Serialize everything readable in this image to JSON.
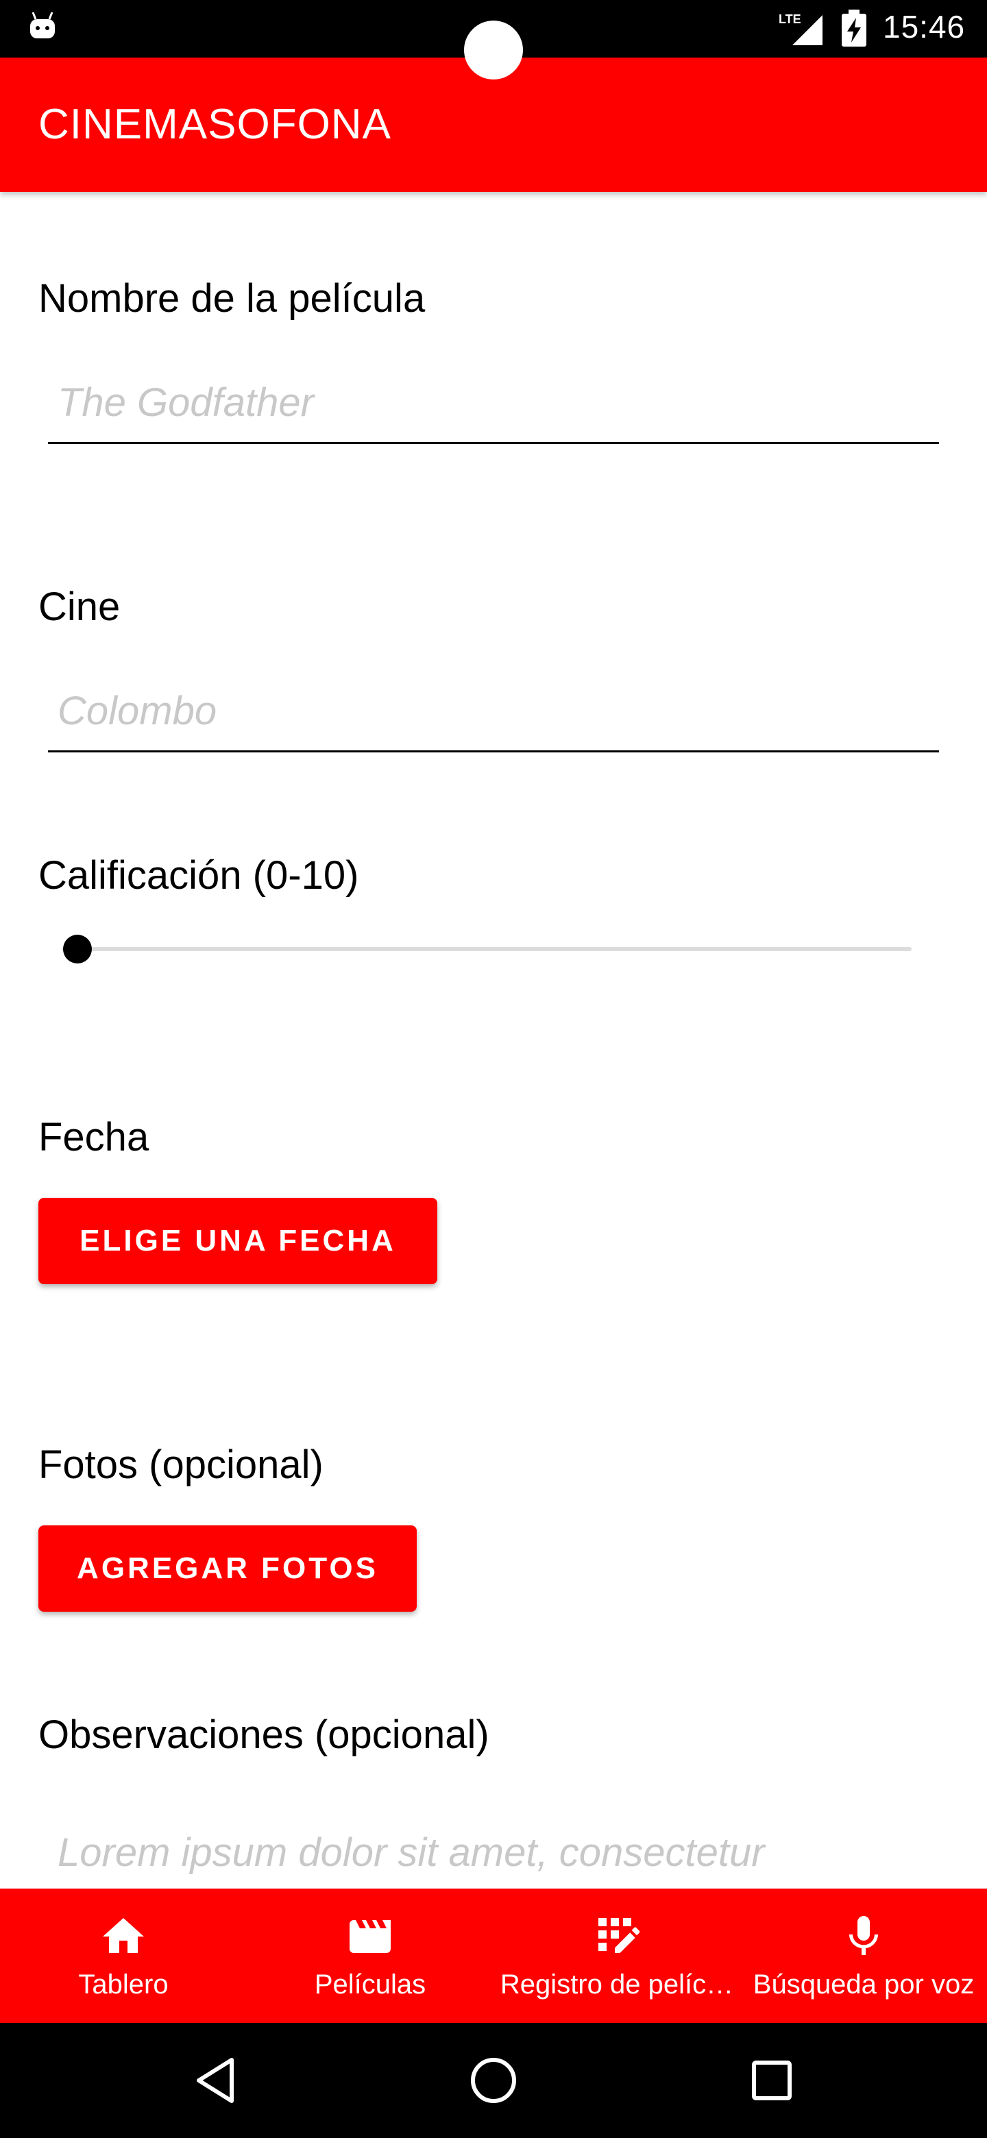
{
  "status_bar": {
    "time": "15:46",
    "lte_label": "LTE",
    "icons": [
      "android-debug-icon",
      "lte-signal-icon",
      "battery-charging-icon"
    ]
  },
  "app_bar": {
    "title": "CINEMASOFONA"
  },
  "form": {
    "movie_name": {
      "label": "Nombre de la película",
      "placeholder": "The Godfather",
      "value": ""
    },
    "cinema": {
      "label": "Cine",
      "placeholder": "Colombo",
      "value": ""
    },
    "rating": {
      "label": "Calificación (0-10)",
      "value": 0,
      "min": 0,
      "max": 10
    },
    "date": {
      "label": "Fecha",
      "button_label": "ELIGE UNA FECHA"
    },
    "photos": {
      "label": "Fotos (opcional)",
      "button_label": "AGREGAR FOTOS"
    },
    "notes": {
      "label": "Observaciones (opcional)",
      "placeholder": "Lorem ipsum dolor sit amet, consectetur"
    }
  },
  "bottom_nav": {
    "items": [
      {
        "label": "Tablero",
        "icon": "home-icon"
      },
      {
        "label": "Películas",
        "icon": "movie-clapper-icon"
      },
      {
        "label": "Registro de pelíc…",
        "icon": "register-edit-icon"
      },
      {
        "label": "Búsqueda por voz",
        "icon": "microphone-icon"
      }
    ]
  },
  "system_nav": {
    "icons": [
      "back-icon",
      "home-circle-icon",
      "recents-icon"
    ]
  },
  "colors": {
    "accent": "#ff0000",
    "placeholder": "#c8c8c8",
    "status_bar": "#000000"
  }
}
